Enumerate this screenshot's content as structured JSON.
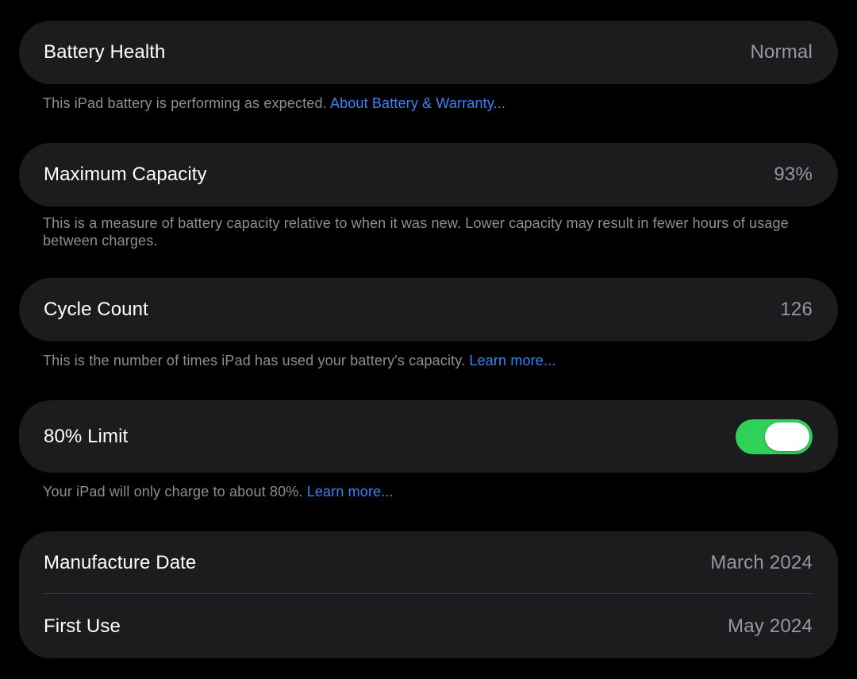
{
  "colors": {
    "background": "#000000",
    "card": "#1c1c1e",
    "label": "#ffffff",
    "value": "#98989d",
    "footnote": "#8e8e93",
    "link": "#3b82f6",
    "toggle_on": "#30d158"
  },
  "battery_health": {
    "label": "Battery Health",
    "value": "Normal",
    "footnote": "This iPad battery is performing as expected.",
    "link": "About Battery & Warranty..."
  },
  "maximum_capacity": {
    "label": "Maximum Capacity",
    "value": "93%",
    "footnote": "This is a measure of battery capacity relative to when it was new. Lower capacity may result in fewer hours of usage between charges."
  },
  "cycle_count": {
    "label": "Cycle Count",
    "value": "126",
    "footnote": "This is the number of times iPad has used your battery's capacity.",
    "link": "Learn more..."
  },
  "limit_80": {
    "label": "80% Limit",
    "toggle_on": true,
    "footnote": "Your iPad will only charge to about 80%.",
    "link": "Learn more..."
  },
  "dates": {
    "manufacture_label": "Manufacture Date",
    "manufacture_value": "March 2024",
    "first_use_label": "First Use",
    "first_use_value": "May 2024"
  }
}
